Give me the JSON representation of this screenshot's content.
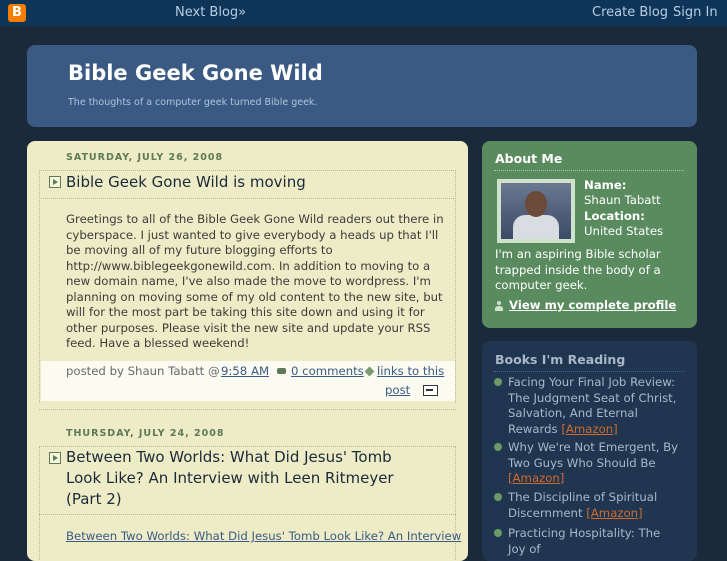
{
  "navbar": {
    "next_blog": "Next Blog»",
    "create_blog": "Create Blog",
    "sign_in": "Sign In"
  },
  "header": {
    "title": "Bible Geek Gone Wild",
    "description": "The thoughts of a computer geek turned Bible geek."
  },
  "posts": [
    {
      "date": "SATURDAY, JULY 26, 2008",
      "title": "Bible Geek Gone Wild is moving",
      "body": "Greetings to all of the Bible Geek Gone Wild readers out there in cyberspace. I just wanted to give everybody a heads up that I'll be moving all of my future blogging efforts to http://www.biblegeekgonewild.com. In addition to moving to a new domain name, I've also made the move to wordpress. I'm planning on moving some of my old content to the new site, but will for the most part be taking this site down and using it for other purposes. Please visit the new site and update your RSS feed. Have a blessed weekend!",
      "posted_by": "posted by Shaun Tabatt @",
      "time": "9:58 AM",
      "comments": "0 comments",
      "links_line1": "links to this",
      "links_line2": "post"
    },
    {
      "date": "THURSDAY, JULY 24, 2008",
      "title": "Between Two Worlds: What Did Jesus' Tomb Look Like? An Interview with Leen Ritmeyer (Part 2)",
      "body_link": "Between Two Worlds: What Did Jesus' Tomb Look Like? An Interview"
    }
  ],
  "about": {
    "heading": "About Me",
    "name_label": "Name:",
    "name": "Shaun Tabatt",
    "location_label": "Location:",
    "location": "United States",
    "bio": "I'm an aspiring Bible scholar trapped inside the body of a computer geek.",
    "profile_link": "View my complete profile"
  },
  "books": {
    "heading": "Books I'm Reading",
    "items": [
      {
        "title": "Facing Your Final Job Review: The Judgment Seat of Christ, Salvation, And Eternal Rewards",
        "link": "[Amazon]"
      },
      {
        "title": "Why We're Not Emergent, By Two Guys Who Should Be",
        "link": "[Amazon]"
      },
      {
        "title": "The Discipline of Spiritual Discernment",
        "link": "[Amazon]"
      },
      {
        "title": "Practicing Hospitality: The Joy of",
        "link": ""
      }
    ]
  },
  "colors": {
    "navbar": "#0e3558",
    "header": "#3a5a83",
    "main_bg": "#eeecc6",
    "about_bg": "#5a8b5e",
    "books_bg": "#203650",
    "amazon": "#d06a2b"
  }
}
